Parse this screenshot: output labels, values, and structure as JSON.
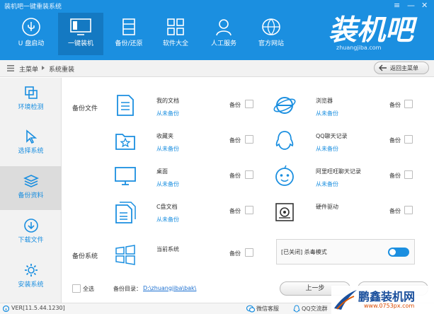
{
  "app": {
    "title": "装机吧一键重装系统",
    "brand_logo_text": "装机吧",
    "brand_url": "zhuangjiba.com"
  },
  "window_controls": [
    "≡",
    "—",
    "✕"
  ],
  "nav": [
    {
      "label": "U 盘启动",
      "icon": "usb-icon"
    },
    {
      "label": "一键装机",
      "icon": "monitor-icon"
    },
    {
      "label": "备份/还原",
      "icon": "database-icon"
    },
    {
      "label": "软件大全",
      "icon": "apps-grid-icon"
    },
    {
      "label": "人工服务",
      "icon": "user-support-icon"
    },
    {
      "label": "官方网站",
      "icon": "globe-icon"
    }
  ],
  "breadcrumb": {
    "root": "主菜单",
    "current": "系统重装"
  },
  "back_to_main": "返回主菜单",
  "sidebar": [
    {
      "label": "环境检测",
      "icon": "scan-icon"
    },
    {
      "label": "选择系统",
      "icon": "cursor-icon"
    },
    {
      "label": "备份资料",
      "icon": "layers-icon"
    },
    {
      "label": "下载文件",
      "icon": "download-icon"
    },
    {
      "label": "安装系统",
      "icon": "gear-icon"
    }
  ],
  "backup_files": {
    "section_label": "备份文件",
    "items": [
      {
        "name": "我的文档",
        "status": "从未备份",
        "backup_label": "备份",
        "icon": "document-icon"
      },
      {
        "name": "浏览器",
        "status": "从未备份",
        "backup_label": "备份",
        "icon": "ie-browser-icon"
      },
      {
        "name": "收藏夹",
        "status": "从未备份",
        "backup_label": "备份",
        "icon": "favorites-folder-icon"
      },
      {
        "name": "QQ聊天记录",
        "status": "从未备份",
        "backup_label": "备份",
        "icon": "qq-penguin-icon"
      },
      {
        "name": "桌面",
        "status": "从未备份",
        "backup_label": "备份",
        "icon": "desktop-monitor-icon"
      },
      {
        "name": "阿里旺旺聊天记录",
        "status": "从未备份",
        "backup_label": "备份",
        "icon": "aliwangwang-icon"
      },
      {
        "name": "C盘文档",
        "status": "从未备份",
        "backup_label": "备份",
        "icon": "c-drive-docs-icon"
      },
      {
        "name": "硬件驱动",
        "status": "",
        "backup_label": "备份",
        "icon": "hardware-driver-icon"
      }
    ]
  },
  "backup_system": {
    "section_label": "备份系统",
    "name": "当前系统",
    "backup_label": "备份",
    "icon": "windows-icon"
  },
  "antivirus": {
    "label": "[已关闭] 杀毒模式",
    "enabled": true
  },
  "footer": {
    "select_all": "全选",
    "backup_dir_label": "备份目录：",
    "backup_dir_path": "D:\\zhuangjiba\\bak\\",
    "prev_button": "上一步"
  },
  "statusbar": {
    "version": "VER[11.5.44.1230]",
    "wechat": "微信客服",
    "qq": "QQ交流群"
  },
  "watermark": {
    "main": "鹏鑫装机网",
    "url": "www.0753px.com"
  },
  "colors": {
    "primary": "#1b8fe0",
    "nav_active": "#1479c2",
    "link": "#1b8fe0"
  }
}
